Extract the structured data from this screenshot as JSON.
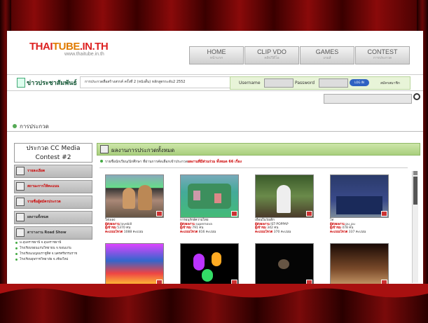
{
  "header": {
    "logo_main": "THAI",
    "logo_mid": "TUBE",
    "logo_end": ".IN.TH",
    "logo_sub": "www.thaitube.in.th"
  },
  "nav": [
    {
      "label": "HOME",
      "sub": "หน้าแรก"
    },
    {
      "label": "CLIP VDO",
      "sub": "คลิปวีดีโอ"
    },
    {
      "label": "GAMES",
      "sub": "เกมส์"
    },
    {
      "label": "CONTEST",
      "sub": "การประกวด"
    }
  ],
  "news": {
    "label": "ข่าวประชาสัมพันธ์",
    "text": "การประกวดสื่อสร้างสรรค์ ครั้งที่ 2 (หนังสั้น) หลักสูตรระดับ2 2552"
  },
  "login": {
    "username_label": "Username",
    "password_label": "Password",
    "login_button": "LOG IN",
    "register_label": "สมัครสมาชิก"
  },
  "breadcrumb": "การประกวด",
  "sidebar": {
    "title": "ประกวด CC Media Contest #2",
    "items": [
      {
        "label": "รายละเอียด"
      },
      {
        "label": "สถานะการให้คะแนน"
      },
      {
        "label": "รายชื่อผู้สมัครประกวด"
      },
      {
        "label": "ผลงานทั้งหมด"
      },
      {
        "label": "ตารางงาน Road Show"
      }
    ],
    "subitems": [
      "ม.อุบลราชธานี จ.อุบลราชธานี",
      "โรงเรียนขอนแก่นวิทยายน จ.ขอนแก่น",
      "โรงเรียนเบญจมราชูทิศ จ.นครศรีธรรมราช",
      "โรงเรียนยุพราชวิทยาลัย จ.เชียงใหม่"
    ]
  },
  "main": {
    "title": "ผลงานการประกวดทั้งหมด",
    "subtitle": "รายชื่อนักเรียน/นักศึกษา ที่ผ่านการคัดเลือกเข้าประกวด",
    "subtitle_count": "ผลงานที่มีส่วนร่วม ทั้งหมด 66 เรื่อง",
    "videos": [
      {
        "title": "ใส่เพลง",
        "by_label": "ผู้ส่งผลงาน",
        "by": "lovebill",
        "views_label": "ผู้เข้าชม",
        "views": "5370 คน",
        "score_label": "คะแนนโหวต",
        "score": "1088 คะแนน"
      },
      {
        "title": "การอนุรักษ์ความไทย",
        "by_label": "ผู้ส่งผลงาน",
        "by": "supernova",
        "views_label": "ผู้เข้าชม",
        "views": "791 คน",
        "score_label": "คะแนนโหวต",
        "score": "816 คะแนน"
      },
      {
        "title": "เพื่อนในวัยเด็ก",
        "by_label": "ผู้ส่งผลงาน",
        "by": "IST-POPPAP",
        "views_label": "ผู้เข้าชม",
        "views": "342 คน",
        "score_label": "คะแนนโหวต",
        "score": "370 คะแนน"
      },
      {
        "title": "ไท",
        "by_label": "ผู้ส่งผลงาน",
        "by": "pu_pu",
        "views_label": "ผู้เข้าชม",
        "views": "478 คน",
        "score_label": "คะแนนโหวต",
        "score": "337 คะแนน"
      }
    ]
  }
}
